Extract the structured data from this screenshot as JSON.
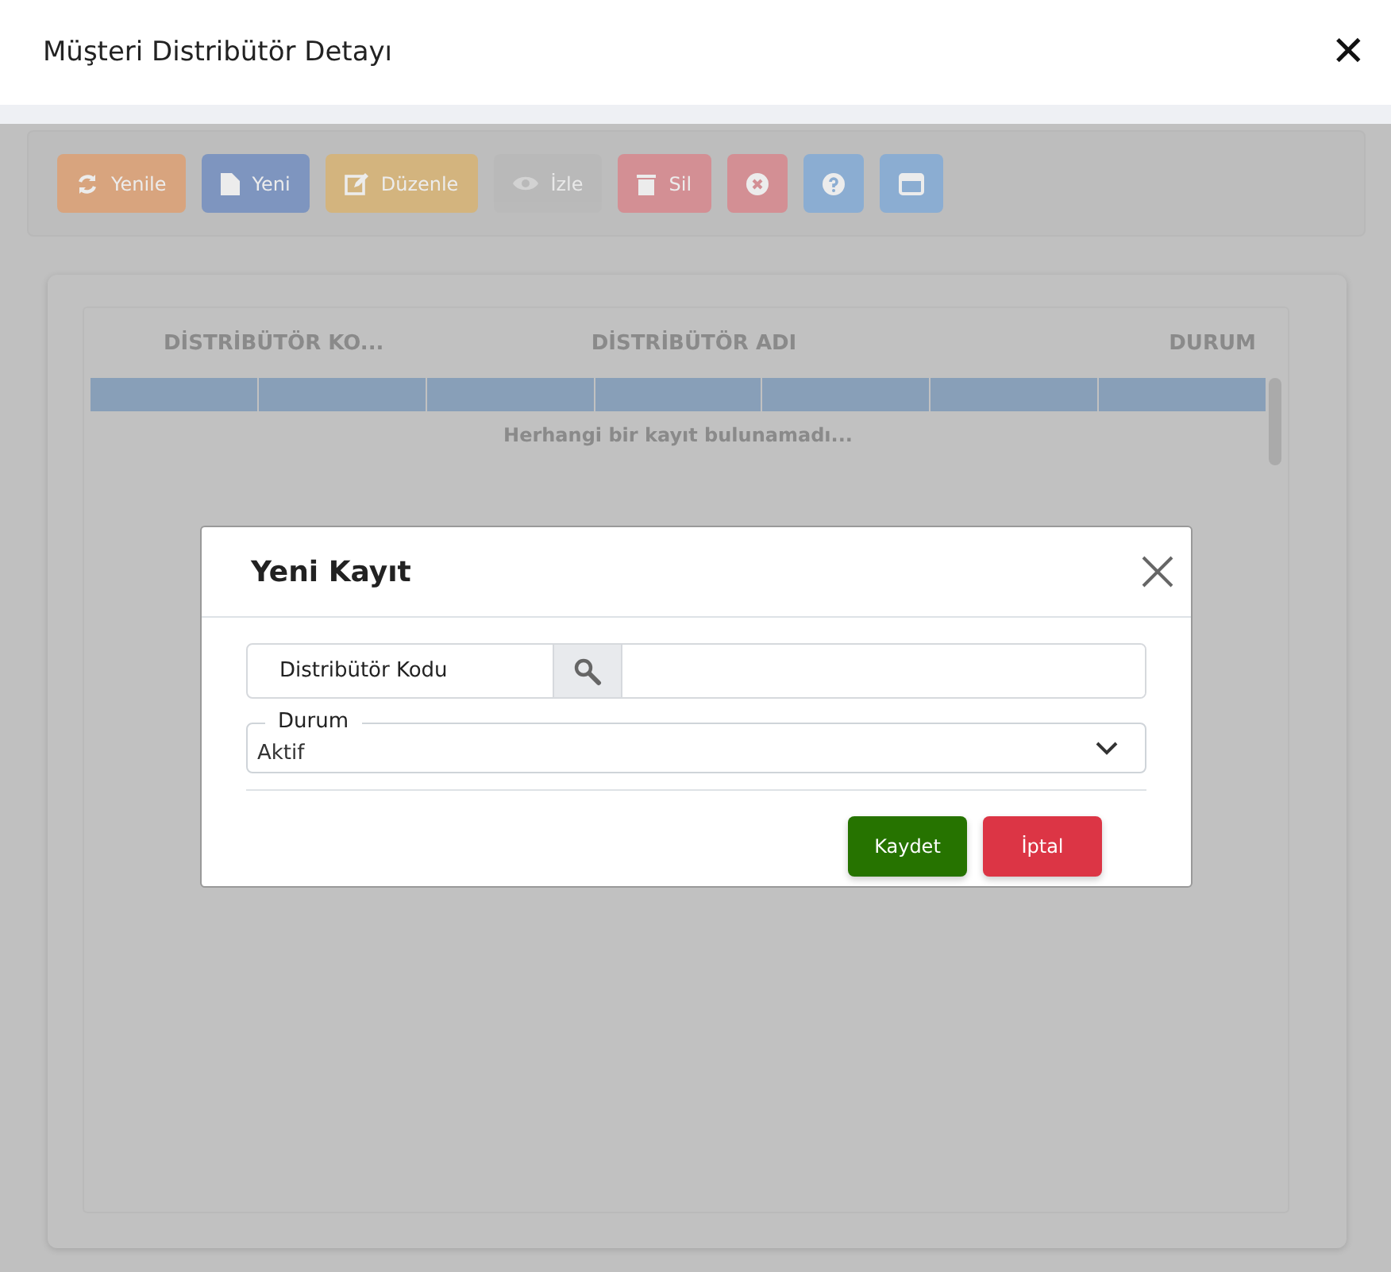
{
  "window": {
    "title": "Müşteri Distribütör Detayı",
    "close": "✕"
  },
  "toolbar": [
    {
      "kind": "refresh",
      "label": "Yenile",
      "disabled": false
    },
    {
      "kind": "new",
      "label": "Yeni",
      "disabled": false
    },
    {
      "kind": "edit",
      "label": "Düzenle",
      "disabled": false
    },
    {
      "kind": "view",
      "label": "İzle",
      "disabled": true
    },
    {
      "kind": "delete",
      "label": "Sil",
      "disabled": false
    },
    {
      "kind": "cancel",
      "disabled": false
    },
    {
      "kind": "help",
      "disabled": false
    },
    {
      "kind": "window",
      "disabled": false
    }
  ],
  "table": {
    "columns": [
      "DİSTRİBÜTÖR KO...",
      "DİSTRİBÜTÖR ADI",
      "DURUM"
    ],
    "empty_message": "Herhangi bir kayıt bulunamadı..."
  },
  "dialog": {
    "title": "Yeni Kayıt",
    "fields": [
      {
        "kind": "lookup",
        "label": "Distribütör Kodu"
      },
      {
        "kind": "select",
        "label": "Durum",
        "value": "Aktif"
      }
    ],
    "buttons": [
      {
        "kind": "primary",
        "label": "Kaydet"
      },
      {
        "kind": "danger",
        "label": "İptal"
      }
    ]
  }
}
